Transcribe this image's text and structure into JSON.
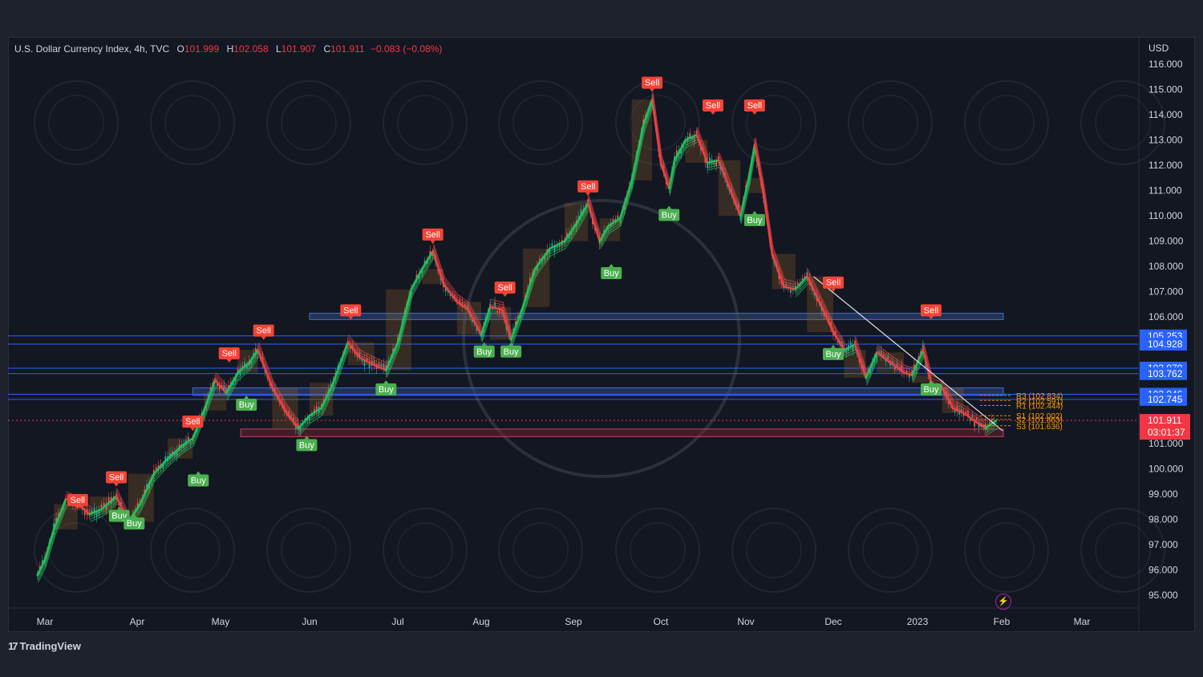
{
  "header": {
    "symbol": "U.S. Dollar Currency Index, 4h, TVC",
    "o_label": "O",
    "o_value": "101.999",
    "h_label": "H",
    "h_value": "102.058",
    "l_label": "L",
    "l_value": "101.907",
    "c_label": "C",
    "c_value": "101.911",
    "change": "−0.083 (−0.08%)"
  },
  "currency": "USD",
  "footer": {
    "brand": "TradingView",
    "logo_icon": "tradingview-logo-icon"
  },
  "colors": {
    "bull": "#22c55e",
    "bear": "#ef4444",
    "buy_label": "#4caf50",
    "sell_label": "#f44336",
    "level_badge": "#2962ff",
    "price_badge": "#f23645",
    "pivot": "#ff9800"
  },
  "chart_data": {
    "type": "candlestick",
    "title": "U.S. Dollar Currency Index, 4h, TVC",
    "ylim": [
      94.5,
      116.6
    ],
    "y_ticks": [
      "95.000",
      "96.000",
      "97.000",
      "98.000",
      "99.000",
      "100.000",
      "101.000",
      "102.000",
      "103.000",
      "104.000",
      "105.000",
      "106.000",
      "107.000",
      "108.000",
      "109.000",
      "110.000",
      "111.000",
      "112.000",
      "113.000",
      "114.000",
      "115.000",
      "116.000"
    ],
    "x_ticks": [
      "Mar",
      "Apr",
      "May",
      "Jun",
      "Jul",
      "Aug",
      "Sep",
      "Oct",
      "Nov",
      "Dec",
      "2023",
      "Feb",
      "Mar"
    ],
    "price_path": [
      {
        "x": "Feb 24",
        "y": 95.8
      },
      {
        "x": "Mar 1",
        "y": 96.4
      },
      {
        "x": "Mar 4",
        "y": 97.6
      },
      {
        "x": "Mar 8",
        "y": 98.8
      },
      {
        "x": "Mar 12",
        "y": 98.6
      },
      {
        "x": "Mar 16",
        "y": 98.2
      },
      {
        "x": "Mar 20",
        "y": 98.4
      },
      {
        "x": "Mar 25",
        "y": 98.9
      },
      {
        "x": "Mar 29",
        "y": 97.9
      },
      {
        "x": "Apr 2",
        "y": 98.6
      },
      {
        "x": "Apr 7",
        "y": 99.8
      },
      {
        "x": "Apr 12",
        "y": 100.4
      },
      {
        "x": "Apr 17",
        "y": 100.9
      },
      {
        "x": "Apr 21",
        "y": 101.2
      },
      {
        "x": "Apr 25",
        "y": 102.3
      },
      {
        "x": "Apr 29",
        "y": 103.5
      },
      {
        "x": "May 3",
        "y": 103.0
      },
      {
        "x": "May 7",
        "y": 103.8
      },
      {
        "x": "May 11",
        "y": 104.2
      },
      {
        "x": "May 14",
        "y": 104.7
      },
      {
        "x": "May 19",
        "y": 103.2
      },
      {
        "x": "May 24",
        "y": 102.2
      },
      {
        "x": "May 28",
        "y": 101.6
      },
      {
        "x": "Jun 1",
        "y": 102.1
      },
      {
        "x": "Jun 5",
        "y": 102.4
      },
      {
        "x": "Jun 9",
        "y": 103.4
      },
      {
        "x": "Jun 14",
        "y": 105.0
      },
      {
        "x": "Jun 18",
        "y": 104.4
      },
      {
        "x": "Jun 23",
        "y": 104.1
      },
      {
        "x": "Jun 27",
        "y": 103.9
      },
      {
        "x": "Jul 1",
        "y": 105.0
      },
      {
        "x": "Jul 6",
        "y": 107.1
      },
      {
        "x": "Jul 10",
        "y": 107.9
      },
      {
        "x": "Jul 14",
        "y": 108.6
      },
      {
        "x": "Jul 18",
        "y": 107.3
      },
      {
        "x": "Jul 23",
        "y": 106.6
      },
      {
        "x": "Jul 27",
        "y": 106.3
      },
      {
        "x": "Aug 1",
        "y": 105.3
      },
      {
        "x": "Aug 4",
        "y": 106.4
      },
      {
        "x": "Aug 8",
        "y": 106.3
      },
      {
        "x": "Aug 11",
        "y": 105.1
      },
      {
        "x": "Aug 15",
        "y": 106.4
      },
      {
        "x": "Aug 19",
        "y": 107.9
      },
      {
        "x": "Aug 24",
        "y": 108.7
      },
      {
        "x": "Aug 29",
        "y": 109.0
      },
      {
        "x": "Sep 2",
        "y": 109.7
      },
      {
        "x": "Sep 6",
        "y": 110.5
      },
      {
        "x": "Sep 10",
        "y": 109.0
      },
      {
        "x": "Sep 13",
        "y": 109.6
      },
      {
        "x": "Sep 17",
        "y": 109.9
      },
      {
        "x": "Sep 21",
        "y": 111.4
      },
      {
        "x": "Sep 25",
        "y": 113.6
      },
      {
        "x": "Sep 28",
        "y": 114.6
      },
      {
        "x": "Oct 1",
        "y": 112.1
      },
      {
        "x": "Oct 4",
        "y": 111.1
      },
      {
        "x": "Oct 6",
        "y": 112.2
      },
      {
        "x": "Oct 10",
        "y": 113.0
      },
      {
        "x": "Oct 14",
        "y": 113.2
      },
      {
        "x": "Oct 18",
        "y": 112.1
      },
      {
        "x": "Oct 22",
        "y": 112.2
      },
      {
        "x": "Oct 26",
        "y": 111.1
      },
      {
        "x": "Oct 30",
        "y": 110.0
      },
      {
        "x": "Nov 2",
        "y": 111.5
      },
      {
        "x": "Nov 4",
        "y": 112.8
      },
      {
        "x": "Nov 7",
        "y": 110.9
      },
      {
        "x": "Nov 10",
        "y": 108.5
      },
      {
        "x": "Nov 14",
        "y": 107.2
      },
      {
        "x": "Nov 18",
        "y": 107.1
      },
      {
        "x": "Nov 22",
        "y": 107.6
      },
      {
        "x": "Nov 27",
        "y": 106.4
      },
      {
        "x": "Dec 1",
        "y": 105.4
      },
      {
        "x": "Dec 5",
        "y": 104.7
      },
      {
        "x": "Dec 9",
        "y": 104.9
      },
      {
        "x": "Dec 13",
        "y": 103.6
      },
      {
        "x": "Dec 17",
        "y": 104.6
      },
      {
        "x": "Dec 22",
        "y": 104.2
      },
      {
        "x": "Dec 27",
        "y": 103.8
      },
      {
        "x": "Dec 30",
        "y": 103.7
      },
      {
        "x": "Jan 3",
        "y": 104.7
      },
      {
        "x": "Jan 6",
        "y": 103.4
      },
      {
        "x": "Jan 10",
        "y": 103.2
      },
      {
        "x": "Jan 14",
        "y": 102.4
      },
      {
        "x": "Jan 18",
        "y": 102.2
      },
      {
        "x": "Jan 22",
        "y": 101.9
      },
      {
        "x": "Jan 26",
        "y": 101.6
      },
      {
        "x": "Jan 30",
        "y": 101.9
      }
    ],
    "signals": [
      {
        "type": "Sell",
        "x": "Mar 12",
        "y": 98.4
      },
      {
        "type": "Sell",
        "x": "Mar 25",
        "y": 99.3
      },
      {
        "type": "Buy",
        "x": "Mar 26",
        "y": 98.5
      },
      {
        "type": "Buy",
        "x": "Mar 31",
        "y": 98.2
      },
      {
        "type": "Buy",
        "x": "Apr 23",
        "y": 99.9
      },
      {
        "type": "Sell",
        "x": "Apr 21",
        "y": 101.5
      },
      {
        "type": "Sell",
        "x": "May 4",
        "y": 104.2
      },
      {
        "type": "Sell",
        "x": "May 16",
        "y": 105.1
      },
      {
        "type": "Buy",
        "x": "May 10",
        "y": 102.9
      },
      {
        "type": "Buy",
        "x": "May 31",
        "y": 101.3
      },
      {
        "type": "Sell",
        "x": "Jun 15",
        "y": 105.9
      },
      {
        "type": "Buy",
        "x": "Jun 27",
        "y": 103.5
      },
      {
        "type": "Sell",
        "x": "Jul 14",
        "y": 108.9
      },
      {
        "type": "Buy",
        "x": "Aug 2",
        "y": 105.0
      },
      {
        "type": "Sell",
        "x": "Aug 9",
        "y": 106.8
      },
      {
        "type": "Buy",
        "x": "Aug 11",
        "y": 105.0
      },
      {
        "type": "Sell",
        "x": "Sep 6",
        "y": 110.8
      },
      {
        "type": "Buy",
        "x": "Sep 14",
        "y": 108.1
      },
      {
        "type": "Sell",
        "x": "Sep 28",
        "y": 114.9
      },
      {
        "type": "Buy",
        "x": "Oct 4",
        "y": 110.4
      },
      {
        "type": "Sell",
        "x": "Oct 20",
        "y": 114.0
      },
      {
        "type": "Sell",
        "x": "Nov 4",
        "y": 114.0
      },
      {
        "type": "Buy",
        "x": "Nov 4",
        "y": 110.2
      },
      {
        "type": "Sell",
        "x": "Dec 1",
        "y": 107.0
      },
      {
        "type": "Buy",
        "x": "Dec 1",
        "y": 104.9
      },
      {
        "type": "Sell",
        "x": "Jan 6",
        "y": 105.9
      },
      {
        "type": "Buy",
        "x": "Jan 6",
        "y": 103.5
      }
    ],
    "horizontal_levels": [
      105.253,
      104.928,
      103.979,
      103.762,
      102.946,
      102.745
    ],
    "zones": [
      {
        "from": 105.9,
        "to": 106.15,
        "x_from": "Jun 1",
        "x_to": "Jan 31"
      },
      {
        "from": 102.9,
        "to": 103.2,
        "x_from": "Apr 21",
        "x_to": "Jan 31"
      },
      {
        "from": 101.27,
        "to": 101.57,
        "x_from": "May 8",
        "x_to": "Jan 31"
      }
    ],
    "current_price": "101.911",
    "countdown": "03:01:37",
    "pivots": [
      "R3 (102.834)",
      "R2 (102.591)",
      "R1 (102.444)",
      "S1 (102.002)",
      "S2 (101.863)",
      "S3 (101.636)"
    ]
  }
}
